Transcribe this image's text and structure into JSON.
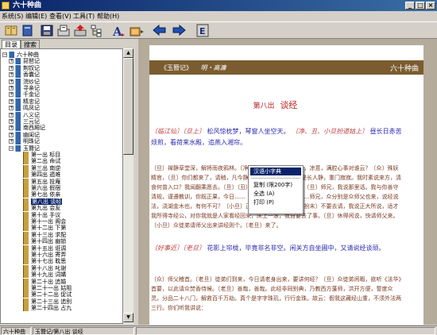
{
  "window": {
    "title": "六十种曲"
  },
  "menu": {
    "items": [
      "系统(S)",
      "编辑(E)",
      "查看(V)",
      "工具(T)",
      "帮助(H)"
    ]
  },
  "toolbar": {
    "icons": [
      "open-book-icon",
      "save-icon",
      "inbox-icon",
      "export-icon",
      "tree-icon",
      "font-icon",
      "color-icon",
      "back-icon",
      "forward-icon",
      "dictionary-icon"
    ],
    "last_label": "E"
  },
  "panel": {
    "tabs": [
      "目录",
      "搜索"
    ]
  },
  "tree": {
    "root": "六十种曲",
    "books": [
      "琵琶记",
      "荆钗记",
      "香囊记",
      "浣纱记",
      "寻亲记",
      "千金记",
      "精忠记",
      "鸣凤记",
      "八义记",
      "三元记",
      "南西厢记",
      "幽闺记",
      "明珠记",
      "玉簪记"
    ],
    "chapters": [
      "第一出 标目",
      "第二出 命试",
      "第三出 南逆",
      "第四出 遁难",
      "第五出 投庵",
      "第六出 假宿",
      "第七出 依亲",
      "第八出 谈经",
      "第九出 会友",
      "第十出 手议",
      "第十一出 阁会",
      "第十二出 下第",
      "第十三出 求配",
      "第十四出 幽锁",
      "第十五出 诳调",
      "第十六出 寄弄",
      "第十七出 耽思",
      "第十八出 叱谢",
      "第十九出 词媾",
      "第二十出 追婚",
      "第二十一出 姑阻",
      "第二十二出 促试",
      "第二十三出 追别",
      "第二十四出 占九"
    ],
    "selected": "第八出 谈经"
  },
  "reader": {
    "header_left": "《玉簪记》",
    "header_author": "明・高濂",
    "header_right": "六十种曲",
    "chapter_num": "第八出",
    "chapter_title": "谈经",
    "p1_role1": "〔临江仙〕〔旦上〕",
    "p1_text1": "松风惊枕梦，琴窗人坐空天。",
    "p1_role2": "〔净、丑、小旦扮道姑上〕",
    "p1_text2": "昼长日赤苦烦煎，看荷来水殿，追燕入湘帘。",
    "p2": "〔旦〕禅静草堂深，解将雨夜鸦林。〔净、丑〕雨子双飞来复去，凉意，满腔心事对谁云？〔众〕殊妖精官，〔旦〕你们都来了，请稍，凡今静参。〔净〕今日时节，是长人静，重门寂寂。我时素说来方，清食何曾入口？我闻翻乘愿去。〔旦〕〔丑〕嗯嗯，凭今弹与我来。〔旦〕师兄，我说那里话。我与你善守清规，谨遵教训，你既正果，今日……〔丑〕听我讲。〔末〕……师兄，众分别是众师父也来，说经说法，浇湖金木也，有何不可？〔小旦〕正是，正是。去请。〔净扮末〕不要去请，我说正大所说，适才我所得寺经公，对你我就是人家看经回来，床上一滚，我自要去了事。〔旦〕休得闲说，快请师父来。〔小旦〕众徒弟请师父出来讲经则个。〔老旦〕来了。",
    "p3_role": "〔好事近〕〔老旦〕",
    "p3_text": "花影上帘栊，毕竟非名非空。闲关方自坐圃中，又请说经谈顽。",
    "p4": "〔众〕师父稽首。〔老旦〕徒弟们到来，今日请老身出来，要讲何经？〔旦〕众徒弟闲暇，欲听《法华》首要，以此请众焚香侍候。〔老旦〕善哉，善哉。此经非同别典，乃教西方蓬师，洪开方便，誓度众灵。分品二十八门，解救百千万劫。真个是字字珠玑，行行金珠。故云：假我这藏经山重，不须外法两三行。你们听我讲说："
  },
  "context_menu": {
    "items": [
      "汉语小字典",
      "复制 (限200字)",
      "全选 (A)",
      "打印 (P)"
    ]
  },
  "status": {
    "panel1": "六十种曲",
    "panel2": "玉簪记/第八出 谈经",
    "panel3": ""
  }
}
